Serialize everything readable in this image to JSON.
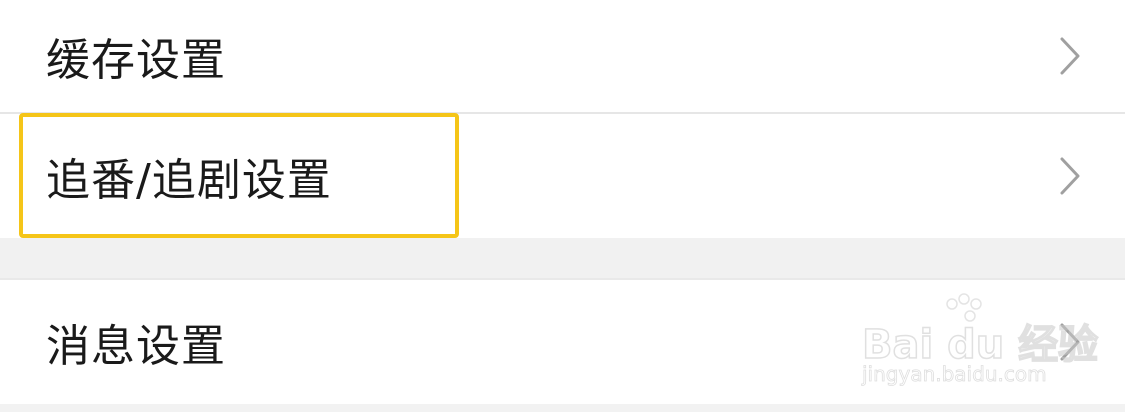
{
  "settings_list": {
    "group_1": [
      {
        "label": "缓存设置",
        "chevron_icon": "chevron-right-icon"
      },
      {
        "label": "追番/追剧设置",
        "chevron_icon": "chevron-right-icon"
      }
    ],
    "group_2": [
      {
        "label": "消息设置",
        "chevron_icon": "chevron-right-icon"
      }
    ]
  },
  "highlight": {
    "target": "追番/追剧设置",
    "color": "#f5c518"
  },
  "watermark": {
    "brand": "Bai du 经验",
    "url": "jingyan.baidu.com"
  },
  "colors": {
    "row_background": "#ffffff",
    "page_background": "#f2f2f2",
    "text": "#1a1a1a",
    "chevron": "#a0a0a0"
  }
}
